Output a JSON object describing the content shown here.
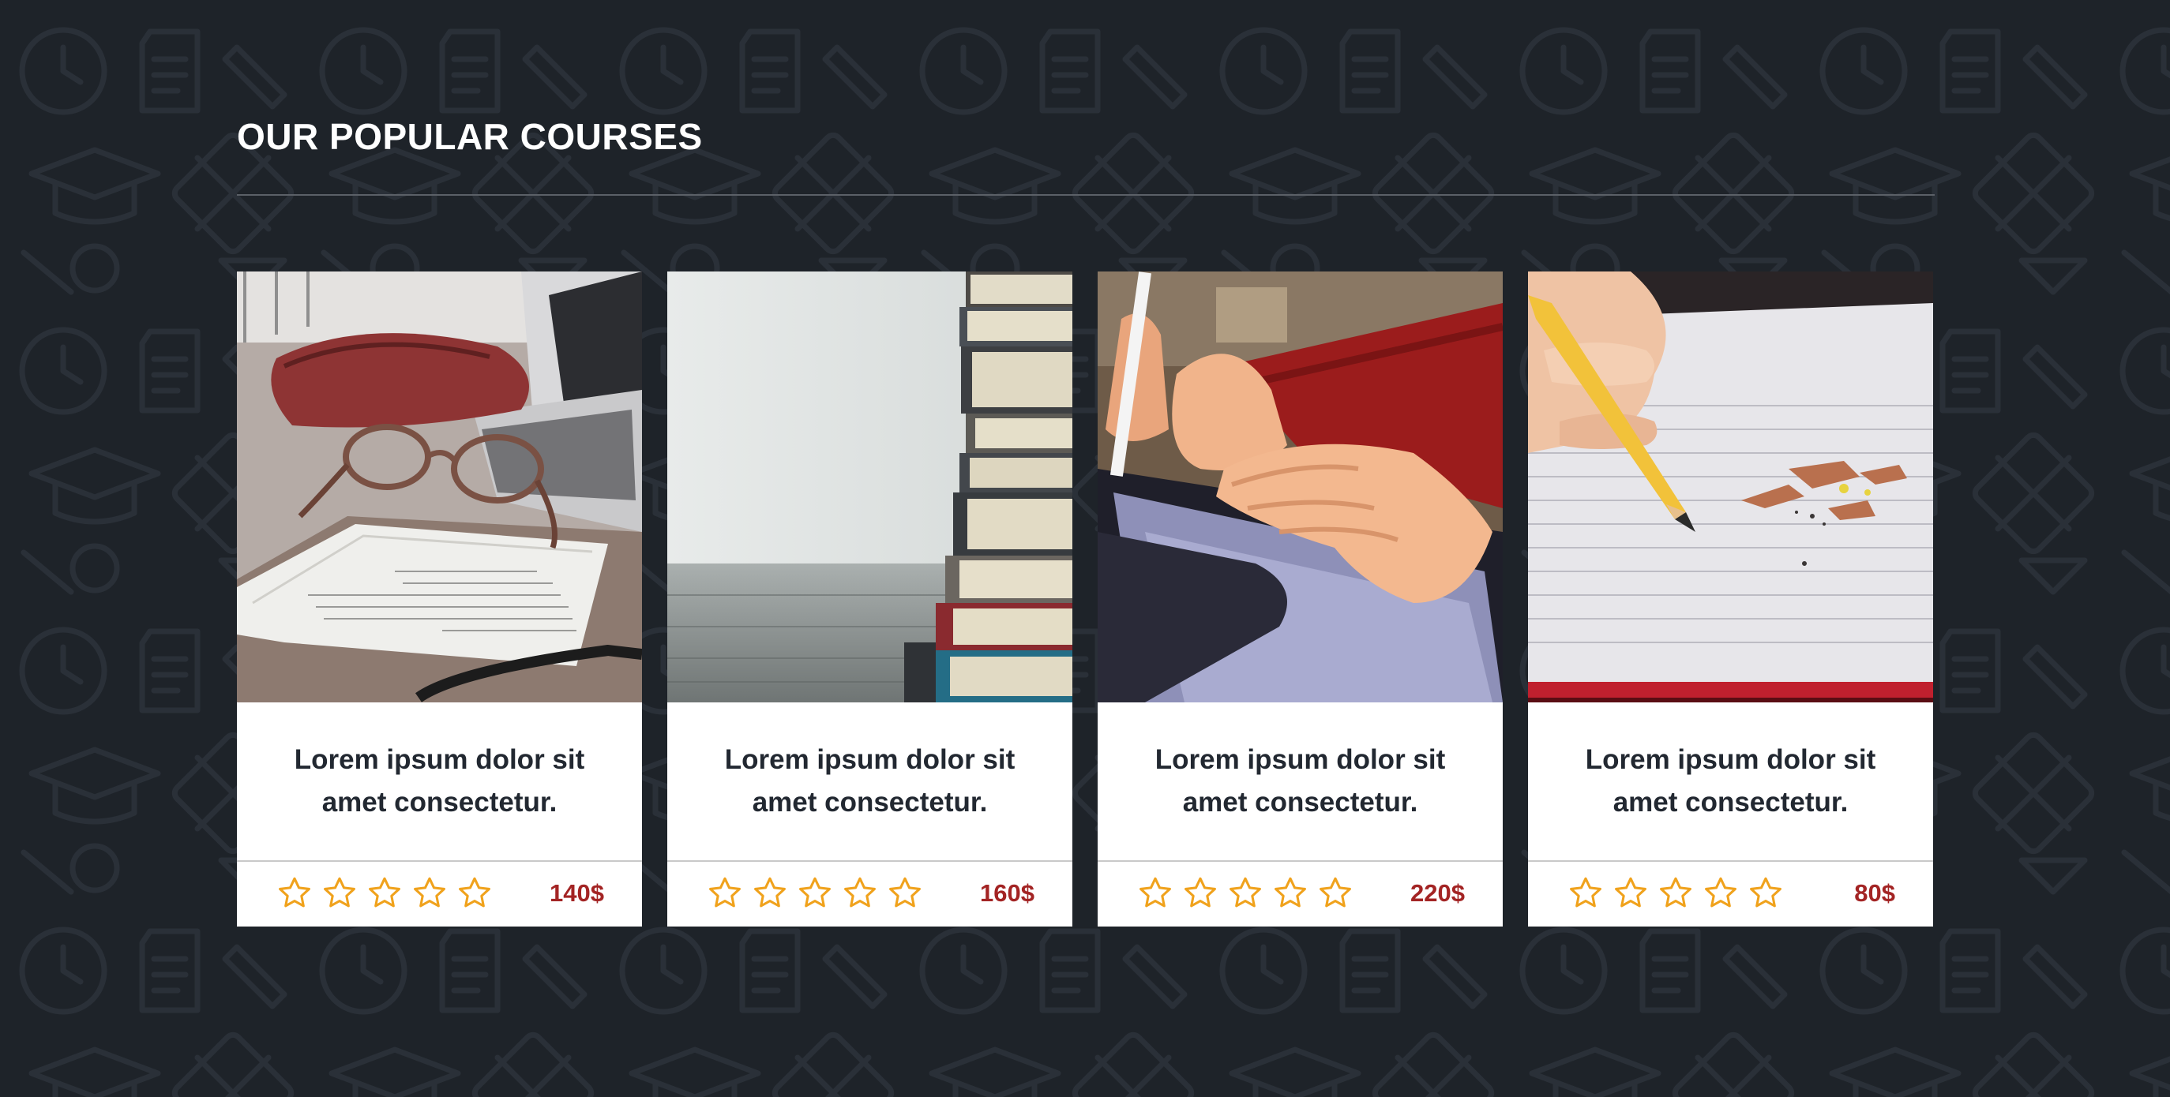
{
  "section": {
    "title": "OUR POPULAR COURSES"
  },
  "colors": {
    "background": "#1e2329",
    "accent_star": "#f0a21c",
    "price": "#a32424",
    "card_text": "#222831"
  },
  "courses": [
    {
      "image": "notebook-glasses-laptop-photo",
      "title": "Lorem ipsum dolor sit amet consectetur.",
      "rating": {
        "icon": "star-outline-icon",
        "filled": 0,
        "max": 5
      },
      "price": "140$"
    },
    {
      "image": "stack-of-books-photo",
      "title": "Lorem ipsum dolor sit amet consectetur.",
      "rating": {
        "icon": "star-outline-icon",
        "filled": 0,
        "max": 5
      },
      "price": "160$"
    },
    {
      "image": "hands-on-tablet-photo",
      "title": "Lorem ipsum dolor sit amet consectetur.",
      "rating": {
        "icon": "star-outline-icon",
        "filled": 0,
        "max": 5
      },
      "price": "220$"
    },
    {
      "image": "pencil-writing-photo",
      "title": "Lorem ipsum dolor sit amet consectetur.",
      "rating": {
        "icon": "star-outline-icon",
        "filled": 0,
        "max": 5
      },
      "price": "80$"
    }
  ]
}
